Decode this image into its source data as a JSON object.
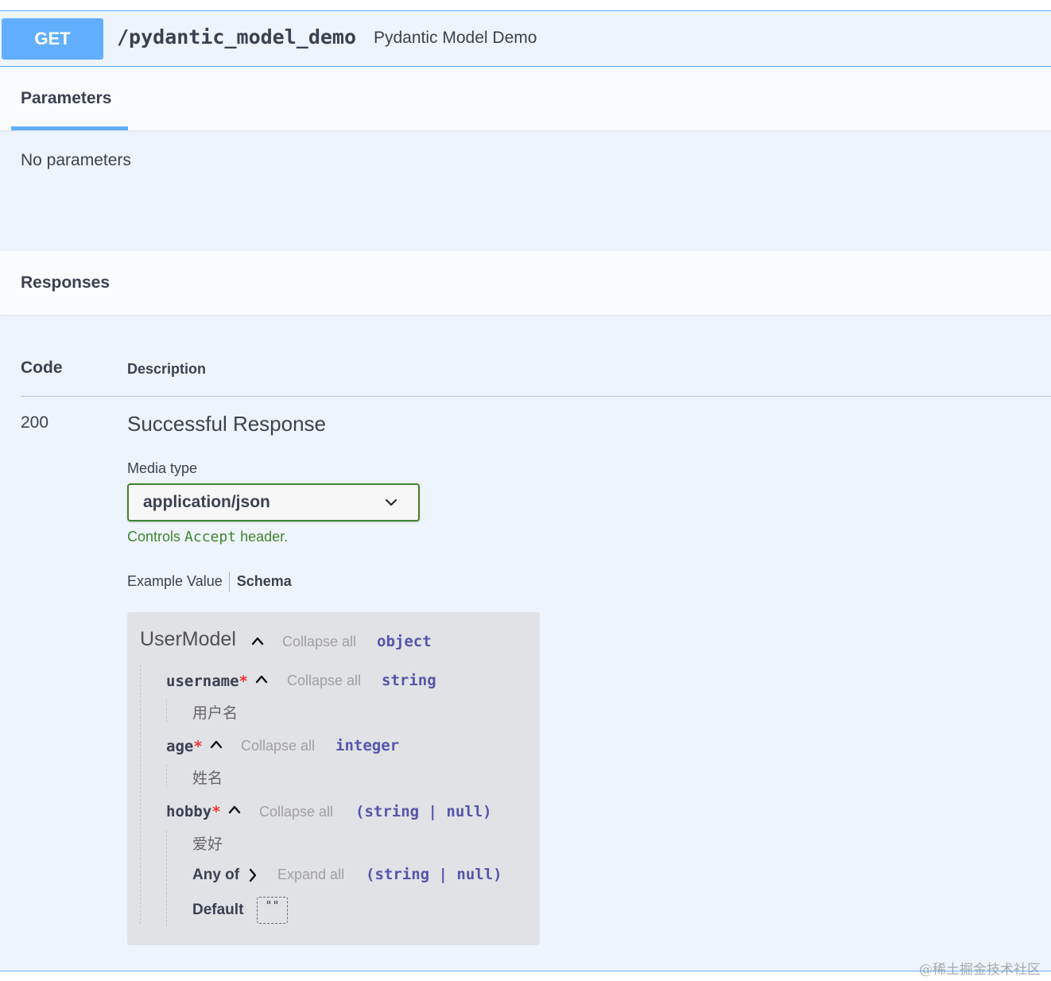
{
  "operation": {
    "method": "GET",
    "path": "/pydantic_model_demo",
    "summary": "Pydantic Model Demo"
  },
  "parameters": {
    "tab_label": "Parameters",
    "empty_text": "No parameters"
  },
  "responses": {
    "section_label": "Responses",
    "col_code": "Code",
    "col_description": "Description",
    "rows": [
      {
        "code": "200",
        "description": "Successful Response",
        "media_type_label": "Media type",
        "media_type_value": "application/json",
        "controls_prefix": "Controls ",
        "controls_mono": "Accept",
        "controls_suffix": " header.",
        "example_tab": "Example Value",
        "schema_tab": "Schema"
      }
    ]
  },
  "schema": {
    "model_name": "UserModel",
    "collapse_label": "Collapse all",
    "model_type": "object",
    "properties": [
      {
        "name": "username",
        "required": "*",
        "type": "string",
        "description": "用户名"
      },
      {
        "name": "age",
        "required": "*",
        "type": "integer",
        "description": "姓名"
      },
      {
        "name": "hobby",
        "required": "*",
        "type": "(string | null)",
        "description": "爱好"
      }
    ],
    "any_of_label": "Any of",
    "expand_all_label": "Expand all",
    "any_of_type": "(string | null)",
    "default_label": "Default",
    "default_value": "\"\""
  },
  "watermark": "@稀土掘金技术社区",
  "colors": {
    "get_blue": "#61affe",
    "block_bg": "#eef4fb",
    "select_border": "#41852e",
    "type_color": "#5555aa",
    "required_star": "#ee3333"
  },
  "icons": [
    "chevron-down-icon",
    "caret-up-icon",
    "chevron-right-icon"
  ]
}
